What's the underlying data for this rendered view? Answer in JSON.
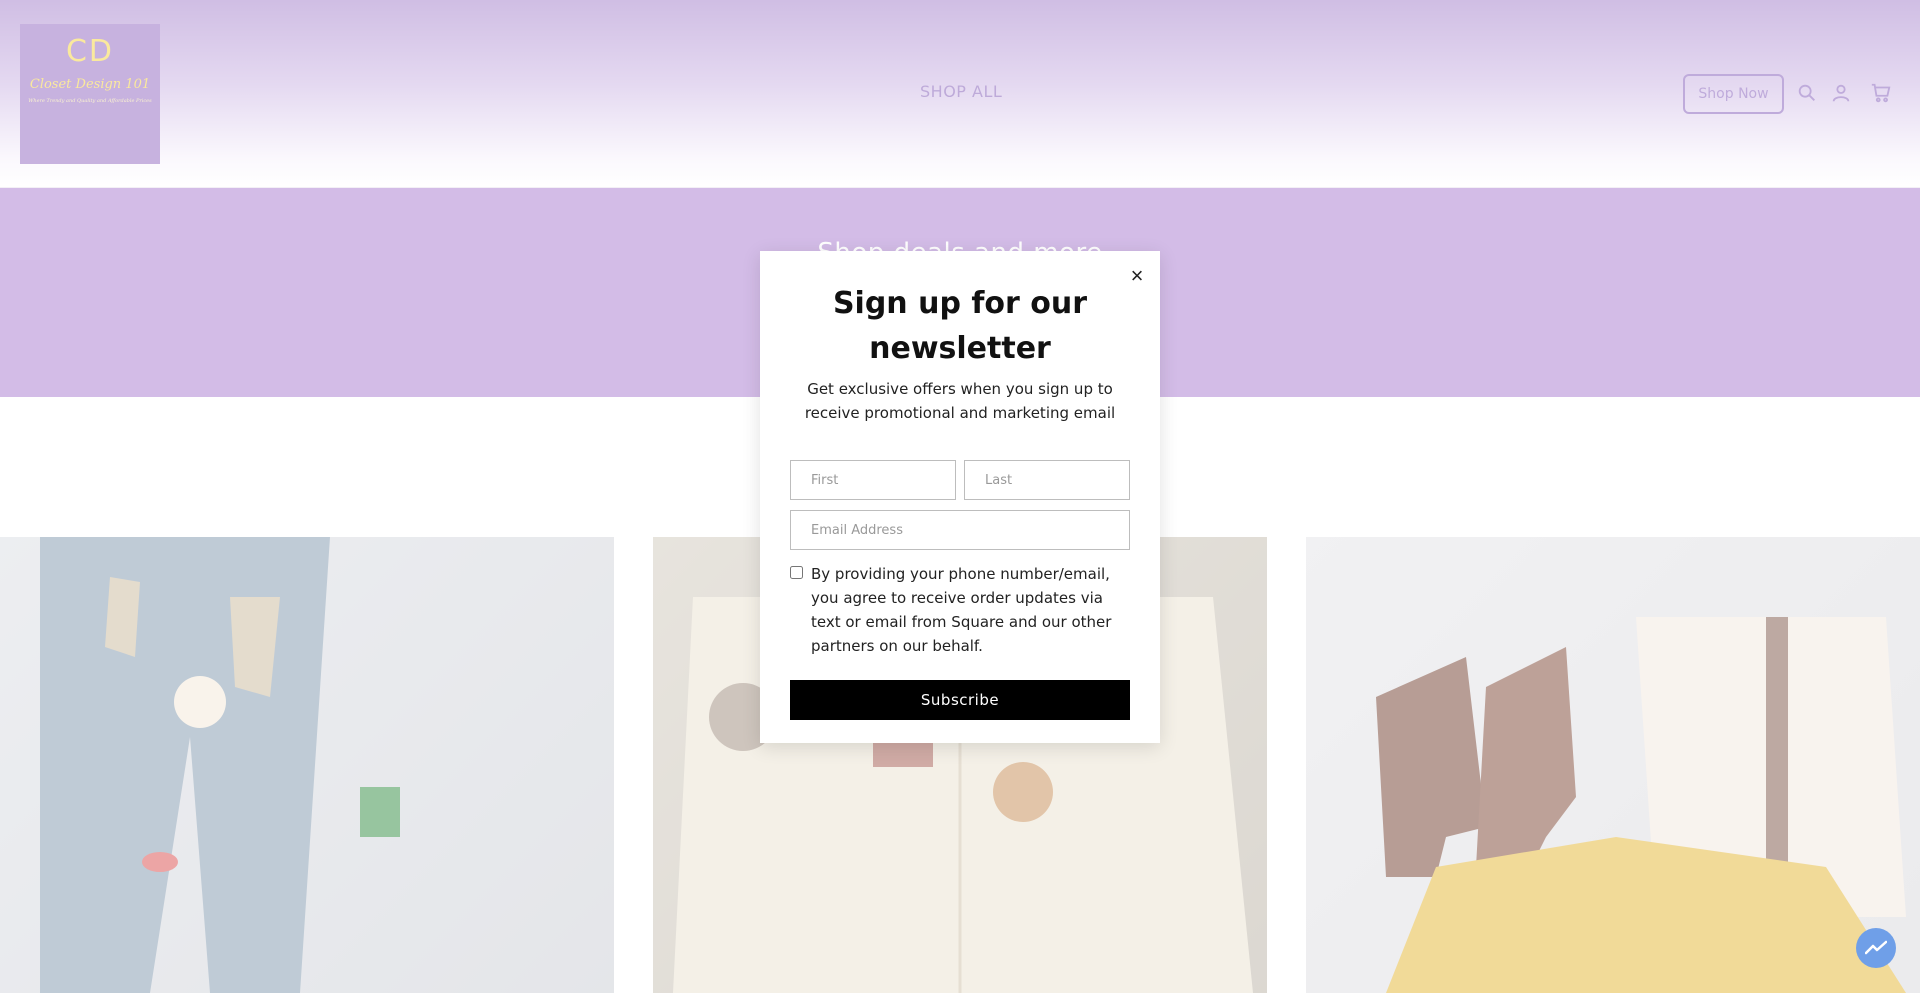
{
  "brand": {
    "logo_initials": "CD",
    "logo_name": "Closet Design 101",
    "logo_tagline": "Where Trendy and Quality and Affordable Prices"
  },
  "header": {
    "nav_shop_all": "SHOP ALL",
    "shop_now_label": "Shop Now",
    "icons": [
      "search-icon",
      "account-icon",
      "cart-icon"
    ]
  },
  "banner": {
    "text": "Shop deals and more"
  },
  "products": [
    {
      "alt": "distressed jeans with patches"
    },
    {
      "alt": "cream varsity jacket with patches"
    },
    {
      "alt": "brown boots, Michael Kors bag and yellow blouse"
    }
  ],
  "modal": {
    "title": "Sign up for our newsletter",
    "subtitle": "Get exclusive offers when you sign up to receive promotional and marketing email",
    "first_placeholder": "First",
    "last_placeholder": "Last",
    "email_placeholder": "Email Address",
    "consent_text": "By providing your phone number/email, you agree to receive order updates via text or email from Square and our other partners on our behalf.",
    "subscribe_label": "Subscribe",
    "close_glyph": "×"
  },
  "colors": {
    "brand_purple": "#a678cf",
    "accent_purple": "#7f57b6",
    "logo_gold": "#f5d23a",
    "subscribe_bg": "#000000"
  }
}
